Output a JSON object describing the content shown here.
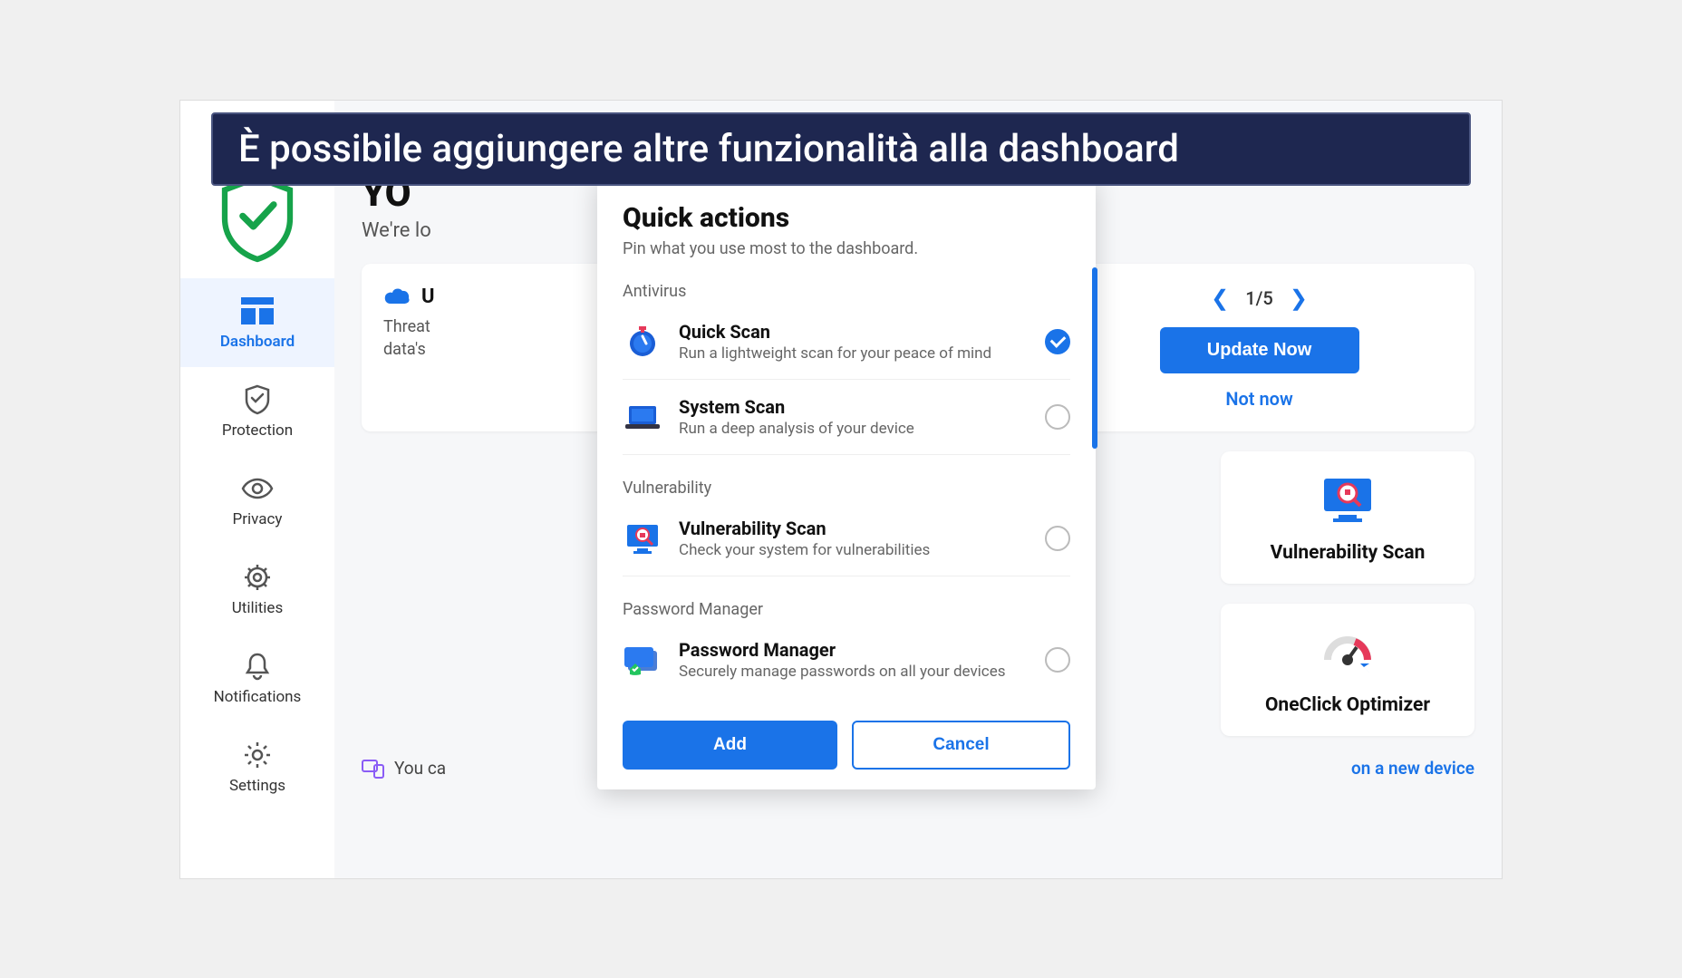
{
  "banner_text": "È possibile aggiungere altre funzionalità alla dashboard",
  "sidebar": {
    "items": [
      {
        "label": "Dashboard"
      },
      {
        "label": "Protection"
      },
      {
        "label": "Privacy"
      },
      {
        "label": "Utilities"
      },
      {
        "label": "Notifications"
      },
      {
        "label": "Settings"
      }
    ]
  },
  "main": {
    "heading_partial": "YO",
    "subheading_partial": "We're lo",
    "card1_title_partial": "U",
    "card1_line1": "Threat",
    "card1_line2": "data's",
    "pager_text": "1/5",
    "update_btn": "Update Now",
    "not_now": "Not now",
    "feature1_title": "Vulnerability Scan",
    "feature2_title": "OneClick Optimizer",
    "bottom_prefix": "You ca",
    "bottom_link": "on a new device"
  },
  "modal": {
    "title": "Quick actions",
    "subtitle": "Pin what you use most to the dashboard.",
    "sections": {
      "antivirus": {
        "label": "Antivirus",
        "items": [
          {
            "title": "Quick Scan",
            "desc": "Run a lightweight scan for your peace of mind",
            "checked": true
          },
          {
            "title": "System Scan",
            "desc": "Run a deep analysis of your device",
            "checked": false
          }
        ]
      },
      "vulnerability": {
        "label": "Vulnerability",
        "items": [
          {
            "title": "Vulnerability Scan",
            "desc": "Check your system for vulnerabilities",
            "checked": false
          }
        ]
      },
      "password": {
        "label": "Password Manager",
        "items": [
          {
            "title": "Password Manager",
            "desc": "Securely manage passwords on all your devices",
            "checked": false
          }
        ]
      }
    },
    "add_btn": "Add",
    "cancel_btn": "Cancel"
  }
}
